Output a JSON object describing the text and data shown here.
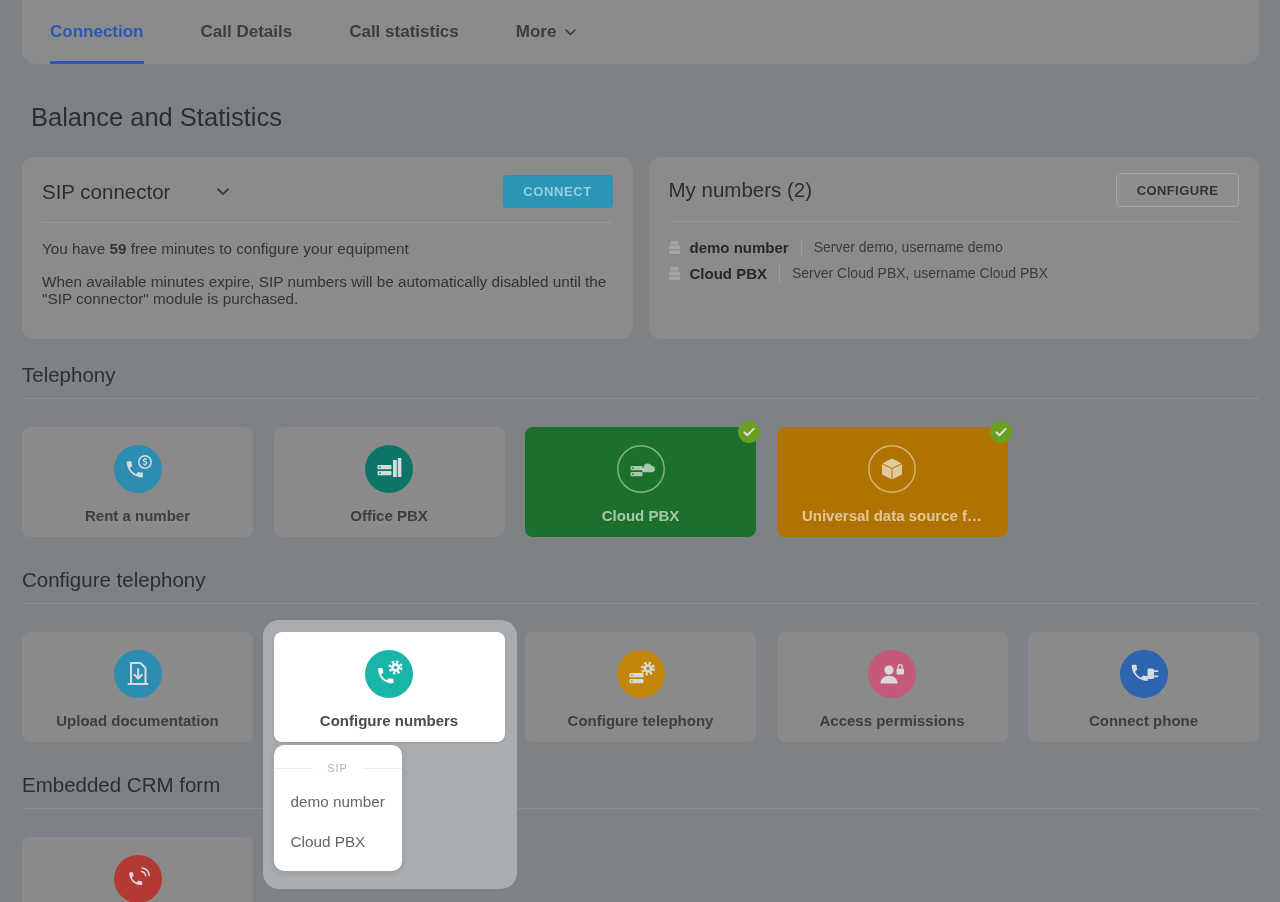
{
  "tabs": [
    {
      "label": "Connection",
      "selected": true,
      "kind": "link"
    },
    {
      "label": "Call Details",
      "selected": false,
      "kind": "link"
    },
    {
      "label": "Call statistics",
      "selected": false,
      "kind": "link"
    },
    {
      "label": "More",
      "selected": false,
      "kind": "menu"
    }
  ],
  "page_title": "Balance and Statistics",
  "sip_card": {
    "title": "SIP connector",
    "button": "CONNECT",
    "paragraphs": [
      "You have **59** free minutes to configure your equipment",
      "When available minutes expire, SIP numbers will be automatically disabled until the \"SIP connector\" module is purchased."
    ]
  },
  "numbers_card": {
    "title": "My numbers (2)",
    "button": "CONFIGURE",
    "numbers": [
      {
        "name": "demo number",
        "details": "Server demo, username demo"
      },
      {
        "name": "Cloud PBX",
        "details": "Server Cloud PBX, username Cloud PBX"
      }
    ]
  },
  "sections": [
    {
      "title": "Telephony",
      "tiles": [
        {
          "label": "Rent a number",
          "color": "#2b8db1",
          "connected": false,
          "selected": false
        },
        {
          "label": "Office PBX",
          "color": "#0f7468",
          "connected": false,
          "selected": false
        },
        {
          "label": "Cloud PBX",
          "color": "#1d702b",
          "connected": true,
          "selected": false
        },
        {
          "label": "Universal data source f…",
          "color": "#b07301",
          "connected": true,
          "selected": false
        }
      ]
    },
    {
      "title": "Configure telephony",
      "tiles": [
        {
          "label": "Upload documentation",
          "color": "#2b8db1",
          "connected": false,
          "selected": false
        },
        {
          "label": "Configure numbers",
          "color": "#19b5a8",
          "connected": false,
          "selected": true
        },
        {
          "label": "Configure telephony",
          "color": "#c2860a",
          "connected": false,
          "selected": false
        },
        {
          "label": "Access permissions",
          "color": "#c65878",
          "connected": false,
          "selected": false
        },
        {
          "label": "Connect phone",
          "color": "#2e63ae",
          "connected": false,
          "selected": false
        }
      ]
    },
    {
      "title": "Embedded CRM form",
      "tiles": [
        {
          "color": "#b33a32",
          "connected": false,
          "selected": false
        }
      ]
    }
  ],
  "popup_menu": {
    "group_label": "SIP",
    "items": [
      "demo number",
      "Cloud PBX"
    ]
  }
}
